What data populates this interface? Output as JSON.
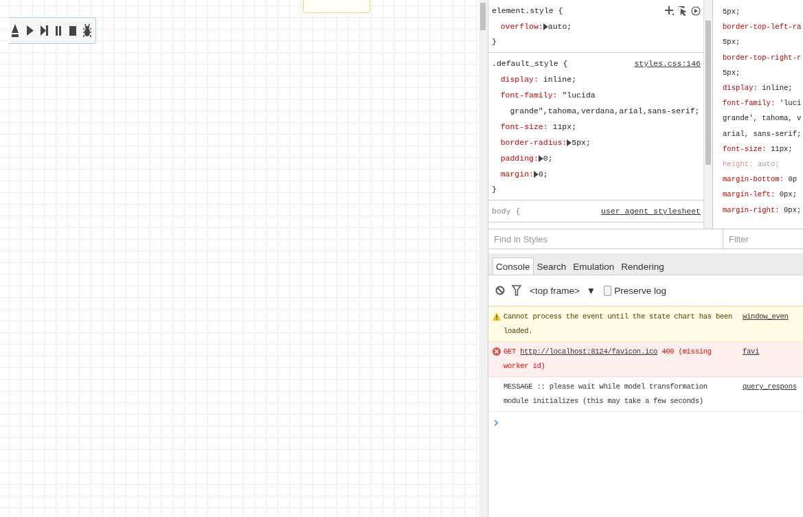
{
  "canvas": {
    "toolbar_buttons": [
      {
        "kind": "eject"
      },
      {
        "kind": "play"
      },
      {
        "kind": "step"
      },
      {
        "kind": "pause"
      },
      {
        "kind": "stop"
      },
      {
        "kind": "debug"
      }
    ]
  },
  "styles": {
    "rules": [
      {
        "selector": "element.style {",
        "close": "}",
        "properties": [
          {
            "name": "overflow:",
            "value": "auto;",
            "expandable": true
          }
        ]
      },
      {
        "selector": ".default_style {",
        "source": "styles.css:146",
        "close": "}",
        "properties": [
          {
            "name": "display:",
            "value": "inline;",
            "expandable": false
          },
          {
            "name": "font-family:",
            "value": "\"lucida grande\",tahoma,verdana,arial,sans-serif;",
            "expandable": false
          },
          {
            "name": "font-size:",
            "value": "11px;",
            "expandable": false
          },
          {
            "name": "border-radius:",
            "value": "5px;",
            "expandable": true
          },
          {
            "name": "padding:",
            "value": "0;",
            "expandable": true
          },
          {
            "name": "margin:",
            "value": "0;",
            "expandable": true
          }
        ]
      },
      {
        "selector": "body {",
        "source": "user agent stylesheet"
      }
    ],
    "find_placeholder": "Find in Styles"
  },
  "computed": {
    "lines": [
      {
        "value": "5px;",
        "dimmed": false
      },
      {
        "name": "border-top-left-ra",
        "dimmed": false
      },
      {
        "value": "5px;",
        "dimmed": false
      },
      {
        "name": "border-top-right-r",
        "dimmed": false
      },
      {
        "value": "5px;",
        "dimmed": false
      },
      {
        "name": "display:",
        "value": "inline;",
        "dimmed": false
      },
      {
        "name": "font-family:",
        "value": "'luci",
        "dimmed": false
      },
      {
        "value": "grande', tahoma, v",
        "dimmed": false
      },
      {
        "value": "arial, sans-serif;",
        "dimmed": false
      },
      {
        "name": "font-size:",
        "value": "11px;",
        "dimmed": false
      },
      {
        "name": "height:",
        "value": "auto;",
        "dimmed": true
      },
      {
        "name": "margin-bottom:",
        "value": "0p",
        "dimmed": false
      },
      {
        "name": "margin-left:",
        "value": "0px;",
        "dimmed": false
      },
      {
        "name": "margin-right:",
        "value": "0px;",
        "dimmed": false
      }
    ],
    "filter_placeholder": "Filter"
  },
  "console": {
    "tabs": [
      {
        "label": "Console",
        "selected": true
      },
      {
        "label": "Search",
        "selected": false
      },
      {
        "label": "Emulation",
        "selected": false
      },
      {
        "label": "Rendering",
        "selected": false
      }
    ],
    "context": "<top frame>",
    "context_arrow": "▼",
    "preserve_log": {
      "label": "Preserve log",
      "checked": false
    },
    "messages": [
      {
        "kind": "warning",
        "text": "Cannot process the event until the state chart has been loaded.",
        "source": "window_even"
      },
      {
        "kind": "error",
        "method": "GET",
        "url": "http://localhost:8124/favicon.ico",
        "text": "400 (missing worker id)",
        "source": "favi"
      },
      {
        "kind": "log",
        "text": "MESSAGE :: please wait while model transformation module initializes (this may take a few seconds)",
        "source": "query_respons"
      }
    ]
  }
}
